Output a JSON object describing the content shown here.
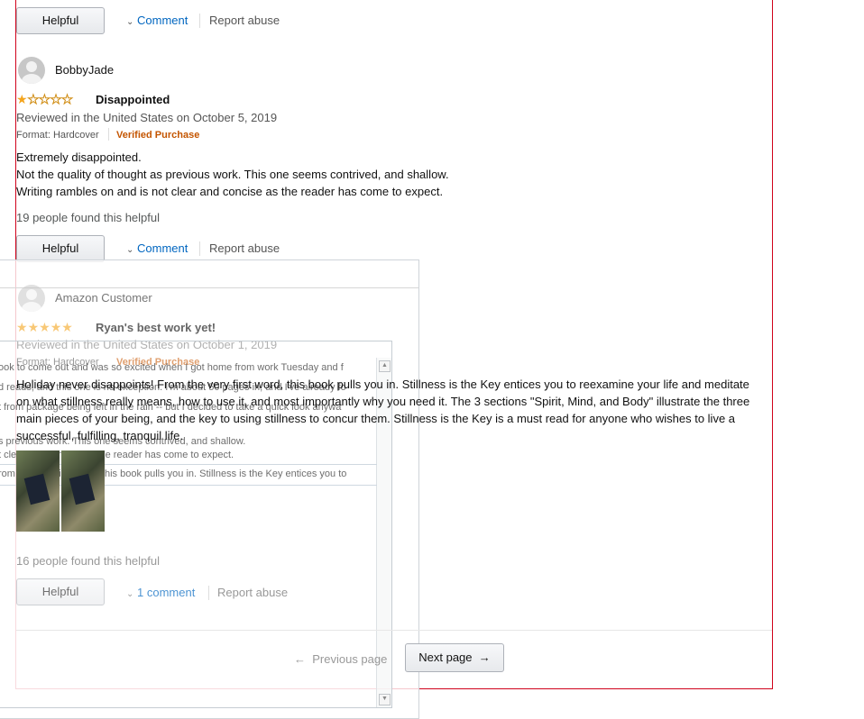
{
  "top_actions": {
    "helpful": "Helpful",
    "comment": "Comment",
    "report": "Report abuse"
  },
  "review1": {
    "author": "BobbyJade",
    "rating": 1,
    "title": "Disappointed",
    "date_line": "Reviewed in the United States on October 5, 2019",
    "format": "Format: Hardcover",
    "verified": "Verified Purchase",
    "body_lines": [
      "Extremely disappointed.",
      "Not the quality of thought as previous work. This one seems contrived, and shallow.",
      "Writing rambles on and is not clear and concise as the reader has come to expect."
    ],
    "helpful_count": "19 people found this helpful",
    "helpful_btn": "Helpful",
    "comment": "Comment",
    "report": "Report abuse"
  },
  "review2": {
    "author": "Amazon Customer",
    "rating": 5,
    "title": "Ryan's best work yet!",
    "date_line": "Reviewed in the United States on October 1, 2019",
    "format": "Format: Hardcover",
    "verified": "Verified Purchase",
    "body_lines": [
      "Holiday never disappoints! From the very first word, this book pulls you in. Stillness is the Key entices you to reexamine your life and meditate",
      "on what stillness really means, how to use it, and most importantly why you need it. The 3 sections \"Spirit, Mind, and Body\" illustrate the three",
      "main pieces of your being, and the key to using stillness to concur them. Stillness is the Key is a must read for anyone who wishes to live a",
      "successful, fulfilling, tranquil life."
    ],
    "helpful_count": "16 people found this helpful",
    "helpful_btn": "Helpful",
    "comment": "1 comment",
    "report": "Report abuse"
  },
  "ghost_lines": [
    "ook to come out and was so excited when I got home from work Tuesday and f",
    "d reads, and this one is no exception. I'm about 50 pages in, and I've already fo",
    "t from package being left in the rain -- but I decided to take a quick look anywa",
    "s previous work. This one seems contrived, and shallow.",
    "t clear and concise as the reader has come to expect.",
    "rom the very first word, this book pulls you in. Stillness is the Key entices you to"
  ],
  "pagination": {
    "previous": "Previous page",
    "next": "Next page"
  },
  "colors": {
    "link": "#0066c0",
    "verified": "#c45500",
    "star": "#f4a41c",
    "frame": "#d0021b"
  }
}
